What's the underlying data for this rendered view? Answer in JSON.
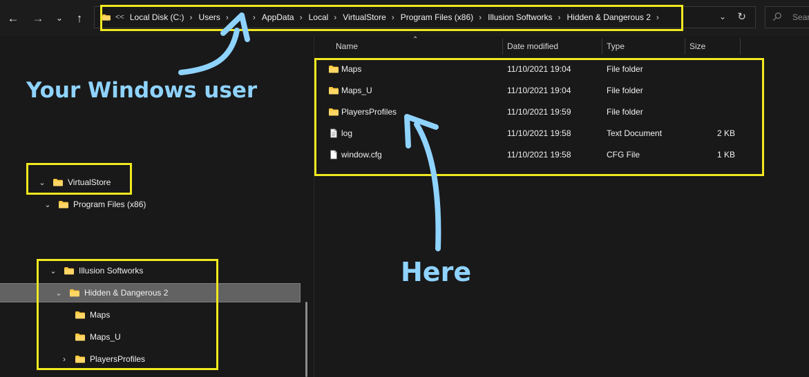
{
  "navigation": {
    "back_icon": "back-arrow-icon",
    "forward_icon": "forward-arrow-icon",
    "recent_icon": "chevron-down-icon",
    "up_icon": "up-arrow-icon"
  },
  "address_bar": {
    "overflow": "<<",
    "segments": [
      "Local Disk (C:)",
      "Users",
      "",
      "AppData",
      "Local",
      "VirtualStore",
      "Program Files (x86)",
      "Illusion Softworks",
      "Hidden & Dangerous 2"
    ],
    "dropdown_icon": "chevron-down-icon",
    "refresh_icon": "refresh-icon"
  },
  "search": {
    "placeholder": "Searc",
    "icon": "search-icon"
  },
  "sidebar": {
    "items": [
      {
        "label": "VirtualStore",
        "icon": "folder-icon",
        "expanded": true
      },
      {
        "label": "Program Files (x86)",
        "icon": "folder-icon",
        "expanded": true
      },
      {
        "label": "Illusion Softworks",
        "icon": "folder-icon",
        "expanded": true
      },
      {
        "label": "Hidden & Dangerous 2",
        "icon": "folder-icon",
        "expanded": true,
        "selected": true
      },
      {
        "label": "Maps",
        "icon": "folder-icon"
      },
      {
        "label": "Maps_U",
        "icon": "folder-icon"
      },
      {
        "label": "PlayersProfiles",
        "icon": "folder-icon",
        "expandable": true
      }
    ]
  },
  "file_list": {
    "columns": {
      "name": "Name",
      "date_modified": "Date modified",
      "type": "Type",
      "size": "Size"
    },
    "sort_icon": "sort-ascending-icon",
    "rows": [
      {
        "name": "Maps",
        "date": "11/10/2021 19:04",
        "type": "File folder",
        "size": "",
        "icon": "folder-icon"
      },
      {
        "name": "Maps_U",
        "date": "11/10/2021 19:04",
        "type": "File folder",
        "size": "",
        "icon": "folder-icon"
      },
      {
        "name": "PlayersProfiles",
        "date": "11/10/2021 19:59",
        "type": "File folder",
        "size": "",
        "icon": "folder-icon"
      },
      {
        "name": "log",
        "date": "11/10/2021 19:58",
        "type": "Text Document",
        "size": "2 KB",
        "icon": "text-document-icon"
      },
      {
        "name": "window.cfg",
        "date": "11/10/2021 19:58",
        "type": "CFG File",
        "size": "1 KB",
        "icon": "document-icon"
      }
    ]
  },
  "annotations": {
    "windows_user": "Your Windows user",
    "here": "Here",
    "highlight_color": "#f1e91f",
    "arrow_color": "#8fd3ff"
  },
  "theme": {
    "background": "#191919",
    "selection": "#626262",
    "folder_yellow": "#ffc83d"
  }
}
